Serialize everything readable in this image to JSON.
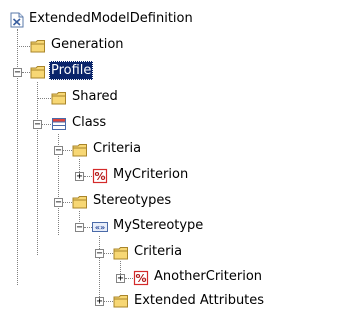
{
  "tree": {
    "nodes": [
      {
        "label": "ExtendedModelDefinition",
        "icon": "extended-model-definition-icon"
      },
      {
        "label": "Generation",
        "icon": "folder-icon"
      },
      {
        "label": "Profile",
        "icon": "folder-icon",
        "selected": true,
        "expanded": true
      },
      {
        "label": "Shared",
        "icon": "folder-icon"
      },
      {
        "label": "Class",
        "icon": "class-metaclass-icon",
        "expanded": true
      },
      {
        "label": "Criteria",
        "icon": "folder-icon",
        "expanded": true
      },
      {
        "label": "MyCriterion",
        "icon": "criterion-icon",
        "expanded": false
      },
      {
        "label": "Stereotypes",
        "icon": "folder-icon",
        "expanded": true
      },
      {
        "label": "MyStereotype",
        "icon": "stereotype-icon",
        "expanded": true
      },
      {
        "label": "Criteria",
        "icon": "folder-icon",
        "expanded": true
      },
      {
        "label": "AnotherCriterion",
        "icon": "criterion-icon",
        "expanded": false
      },
      {
        "label": "Extended Attributes",
        "icon": "folder-icon",
        "expanded": false
      }
    ]
  },
  "icons": {
    "criterion_glyph": "%",
    "stereotype_glyph": "«»"
  },
  "colors": {
    "selection": "#0a246a",
    "folder": "#f7d774",
    "tree_lines": "#808080"
  }
}
